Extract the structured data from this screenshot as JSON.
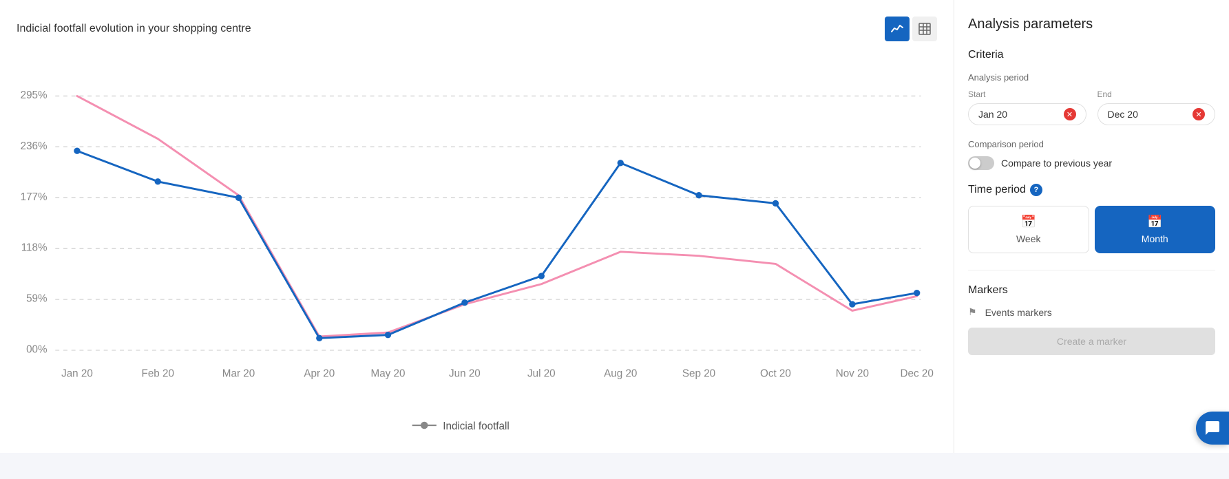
{
  "page": {
    "title": "Indicial footfall evolution in your shopping centre"
  },
  "toolbar": {
    "line_chart_icon": "📈",
    "table_icon": "⊞"
  },
  "chart": {
    "y_labels": [
      "295%",
      "236%",
      "177%",
      "118%",
      "59%",
      "00%"
    ],
    "x_labels": [
      "Jan 20",
      "Feb 20",
      "Mar 20",
      "Apr 20",
      "May 20",
      "Jun 20",
      "Jul 20",
      "Aug 20",
      "Sep 20",
      "Oct 20",
      "Nov 20",
      "Dec 20"
    ],
    "legend_label": "Indicial footfall",
    "colors": {
      "blue_line": "#1565c0",
      "pink_line": "#f48fb1",
      "grid": "#ddd"
    }
  },
  "right_panel": {
    "title": "Analysis parameters",
    "criteria_label": "Criteria",
    "analysis_period_label": "Analysis period",
    "start_label": "Start",
    "end_label": "End",
    "start_value": "Jan 20",
    "end_value": "Dec 20",
    "comparison_period_label": "Comparison period",
    "compare_toggle_label": "Compare to previous year",
    "time_period_label": "Time period",
    "week_label": "Week",
    "month_label": "Month",
    "markers_label": "Markers",
    "events_markers_label": "Events markers",
    "create_marker_label": "Create a marker",
    "help_icon": "?",
    "calendar_icon": "📅"
  }
}
